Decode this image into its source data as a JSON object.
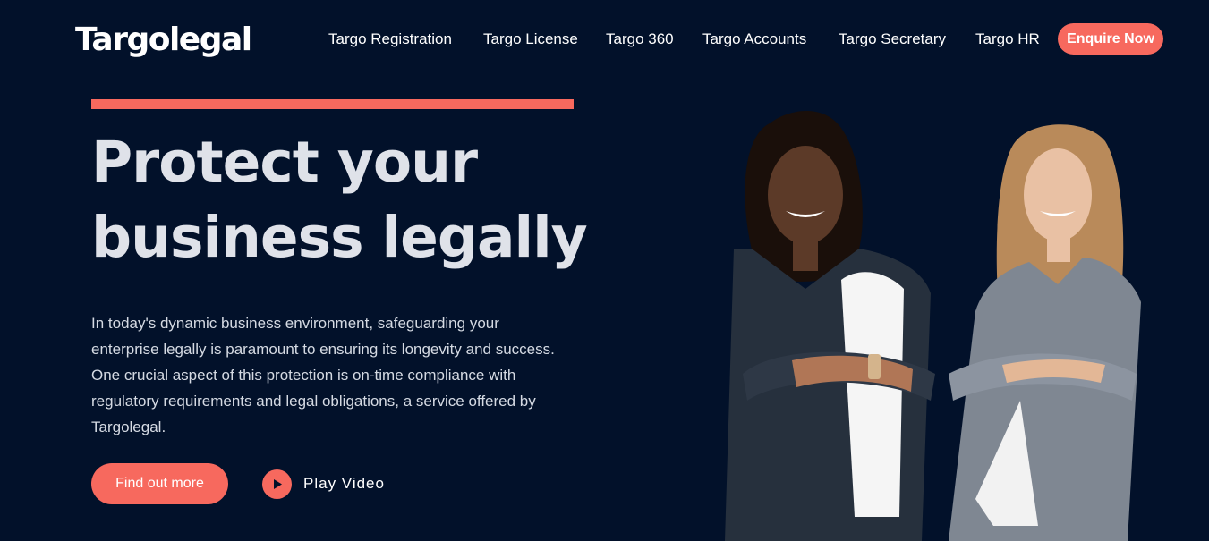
{
  "brand": {
    "logo_text": "Targolegal"
  },
  "nav": {
    "items": [
      {
        "label": "Targo Registration"
      },
      {
        "label": "Targo License"
      },
      {
        "label": "Targo 360"
      },
      {
        "label": "Targo Accounts"
      },
      {
        "label": "Targo Secretary"
      },
      {
        "label": "Targo HR"
      }
    ],
    "enquire_label": "Enquire Now"
  },
  "hero": {
    "headline_line1": "Protect your",
    "headline_line2": "business legally",
    "body": "In today's dynamic business environment, safeguarding your enterprise legally is paramount to ensuring its longevity and success. One crucial aspect of this protection is on-time compliance with regulatory requirements and legal obligations, a service offered by Targolegal.",
    "cta_label": "Find out more",
    "video_label": "Play Video",
    "video_icon": "play-icon"
  },
  "colors": {
    "background": "#02112a",
    "accent": "#f7695e",
    "headline": "#dfe2e9",
    "body_text": "#d5dae3"
  }
}
